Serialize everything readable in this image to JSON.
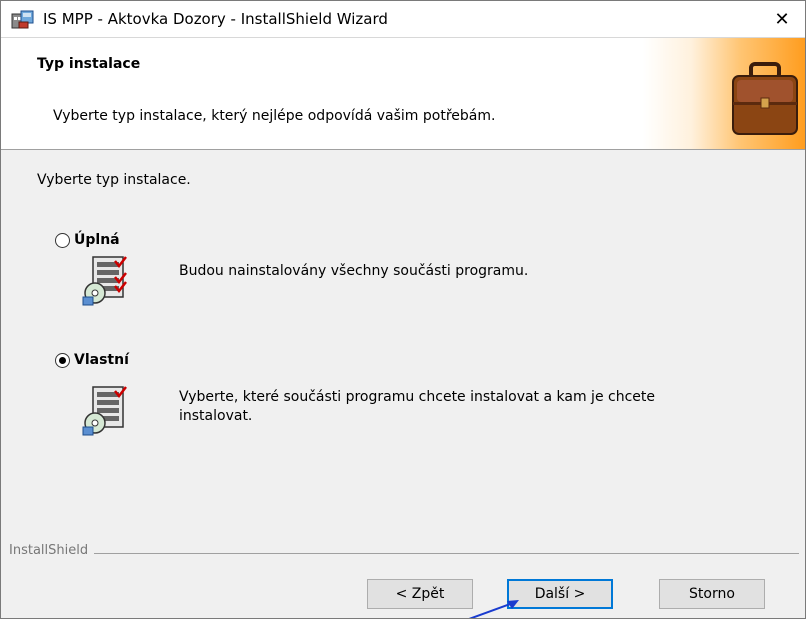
{
  "window": {
    "title": "IS MPP - Aktovka Dozory - InstallShield Wizard",
    "close_glyph": "✕"
  },
  "banner": {
    "title": "Typ instalace",
    "description": "Vyberte typ instalace, který nejlépe odpovídá vašim potřebám.",
    "art_icon": "briefcase-icon"
  },
  "main": {
    "prompt": "Vyberte typ instalace.",
    "options": [
      {
        "label": "Úplná",
        "description": "Budou nainstalovány všechny součásti programu.",
        "selected": false,
        "icon": "setup-components-icon"
      },
      {
        "label": "Vlastní",
        "description": "Vyberte, které součásti programu chcete instalovat a kam je chcete instalovat.",
        "selected": true,
        "icon": "setup-components-icon"
      }
    ]
  },
  "footer": {
    "brand": "InstallShield",
    "buttons": {
      "back": "< Zpět",
      "next": "Další >",
      "cancel": "Storno"
    }
  },
  "colors": {
    "accent": "#0078d7",
    "banner_gradient_end": "#ff9d1f",
    "dialog_bg": "#f0f0f0"
  }
}
